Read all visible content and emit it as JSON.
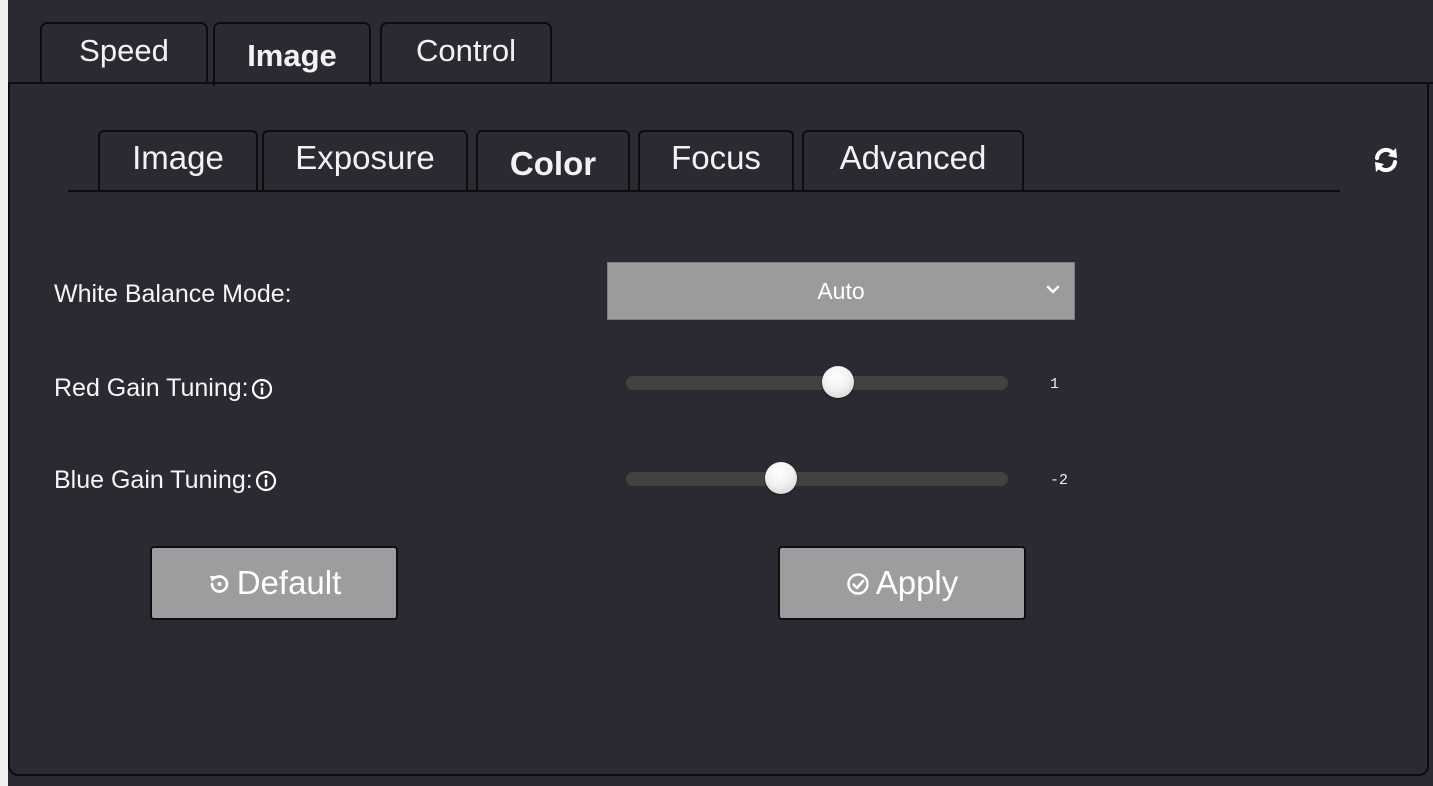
{
  "top_tabs": [
    {
      "label": "Speed"
    },
    {
      "label": "Image",
      "active": true
    },
    {
      "label": "Control"
    }
  ],
  "sub_tabs": [
    {
      "label": "Image"
    },
    {
      "label": "Exposure"
    },
    {
      "label": "Color",
      "active": true
    },
    {
      "label": "Focus"
    },
    {
      "label": "Advanced"
    }
  ],
  "white_balance": {
    "label": "White Balance Mode:",
    "value": "Auto"
  },
  "red_gain": {
    "label": "Red Gain Tuning:",
    "value": "1",
    "fraction": 0.555
  },
  "blue_gain": {
    "label": "Blue Gain Tuning:",
    "value": "-2",
    "fraction": 0.405
  },
  "buttons": {
    "default_label": "Default",
    "apply_label": "Apply"
  },
  "colors": {
    "background": "#2b2a32",
    "border": "#0c0c0e",
    "control_gray": "#9b9b9e",
    "text": "#f2f2f2"
  },
  "icons": {
    "refresh": "refresh-icon",
    "info": "info-icon",
    "chevron": "chevron-down-icon",
    "default": "reset-icon",
    "apply": "check-circle-icon"
  }
}
